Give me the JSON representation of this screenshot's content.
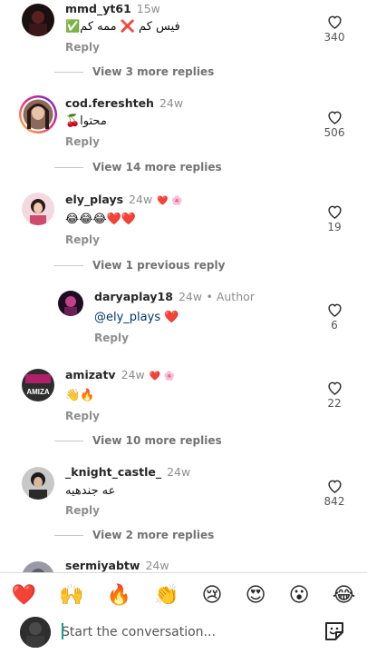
{
  "comments": [
    {
      "username": "mmd_yt61",
      "time": "15w",
      "text": "فیس کم ❌ ممه کم✅",
      "reply": "Reply",
      "likes": "340",
      "more": "View 3 more replies"
    },
    {
      "username": "cod.fereshteh",
      "time": "24w",
      "text": "محتوا🍒",
      "reply": "Reply",
      "likes": "506",
      "more": "View 14 more replies"
    },
    {
      "username": "ely_plays",
      "time": "24w",
      "badge": "❤️ 🌸",
      "text": "😂😂😂❤️❤️",
      "reply": "Reply",
      "likes": "19",
      "more": "View 1 previous reply"
    },
    {
      "username": "daryaplay18",
      "time": "24w",
      "author_label": "• Author",
      "mention": "@ely_plays",
      "text_suffix": " ❤️",
      "reply": "Reply",
      "likes": "6"
    },
    {
      "username": "amizatv",
      "time": "24w",
      "badge": "❤️ 🌸",
      "avatar_text": "AMIZA",
      "text": "👋🔥",
      "reply": "Reply",
      "likes": "22",
      "more": "View 10 more replies"
    },
    {
      "username": "_knight_castle_",
      "time": "24w",
      "text": "عه جندهیه",
      "reply": "Reply",
      "likes": "842",
      "more": "View 2 more replies"
    },
    {
      "username": "sermiyabtw",
      "time": "24w"
    }
  ],
  "emoji_bar": [
    "❤️",
    "🙌",
    "🔥",
    "👏",
    "😢",
    "😍",
    "😮",
    "😂"
  ],
  "input": {
    "placeholder": "Start the conversation..."
  },
  "colors": {
    "mention": "#00376b",
    "muted": "#8e8e8e",
    "story_ring": "#e1306c"
  }
}
